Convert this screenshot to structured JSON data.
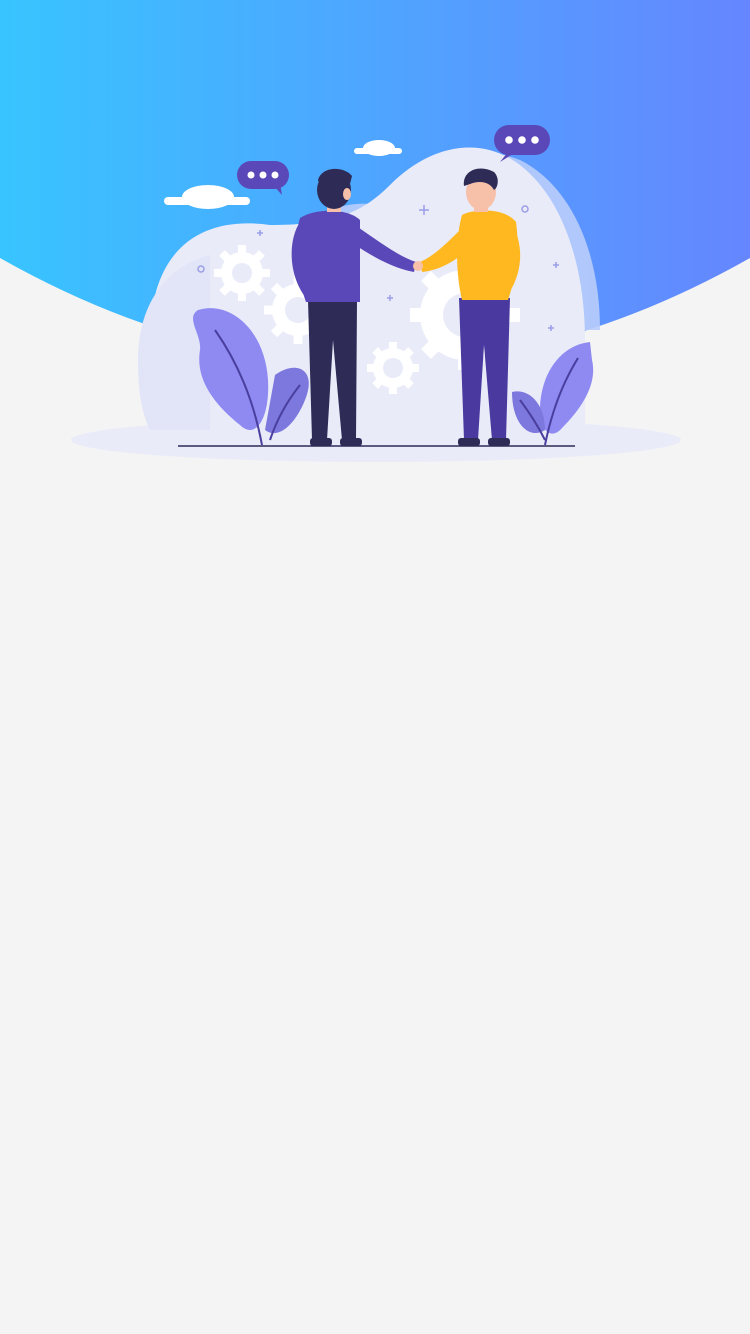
{
  "screen": {
    "name": "splash",
    "colors": {
      "background": "#f4f4f4",
      "gradient_start": "#38c4ff",
      "gradient_end": "#6586ff",
      "purple": "#5a48b8",
      "navy": "#2f2b57",
      "yellow": "#ffb81f",
      "skin": "#f6c1a8",
      "plant": "#8e8af2",
      "hill": "#e9ebf9"
    }
  },
  "illustration": {
    "subject": "two-people-handshake",
    "icons": [
      "speech-bubble-icon",
      "speech-bubble-icon",
      "cloud-icon",
      "cloud-icon",
      "gear-icon",
      "gear-icon",
      "gear-icon",
      "leaf-icon",
      "leaf-icon"
    ]
  }
}
